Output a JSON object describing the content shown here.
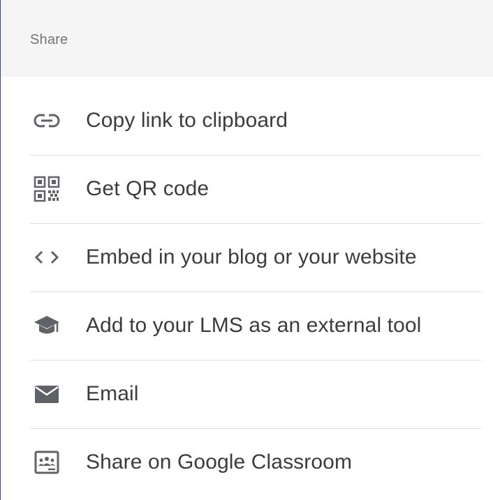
{
  "header": {
    "title": "Share"
  },
  "menu": {
    "items": [
      {
        "label": "Copy link to clipboard",
        "icon": "link-icon"
      },
      {
        "label": "Get QR code",
        "icon": "qr-code-icon"
      },
      {
        "label": "Embed in your blog or your website",
        "icon": "code-icon"
      },
      {
        "label": "Add to your LMS as an external tool",
        "icon": "graduation-cap-icon"
      },
      {
        "label": "Email",
        "icon": "email-icon"
      },
      {
        "label": "Share on Google Classroom",
        "icon": "google-classroom-icon"
      }
    ]
  },
  "colors": {
    "header_background": "#f5f5f5",
    "header_text": "#757575",
    "icon": "#5f6368",
    "label_text": "#3c3c3c",
    "divider": "#dcdcdc"
  }
}
